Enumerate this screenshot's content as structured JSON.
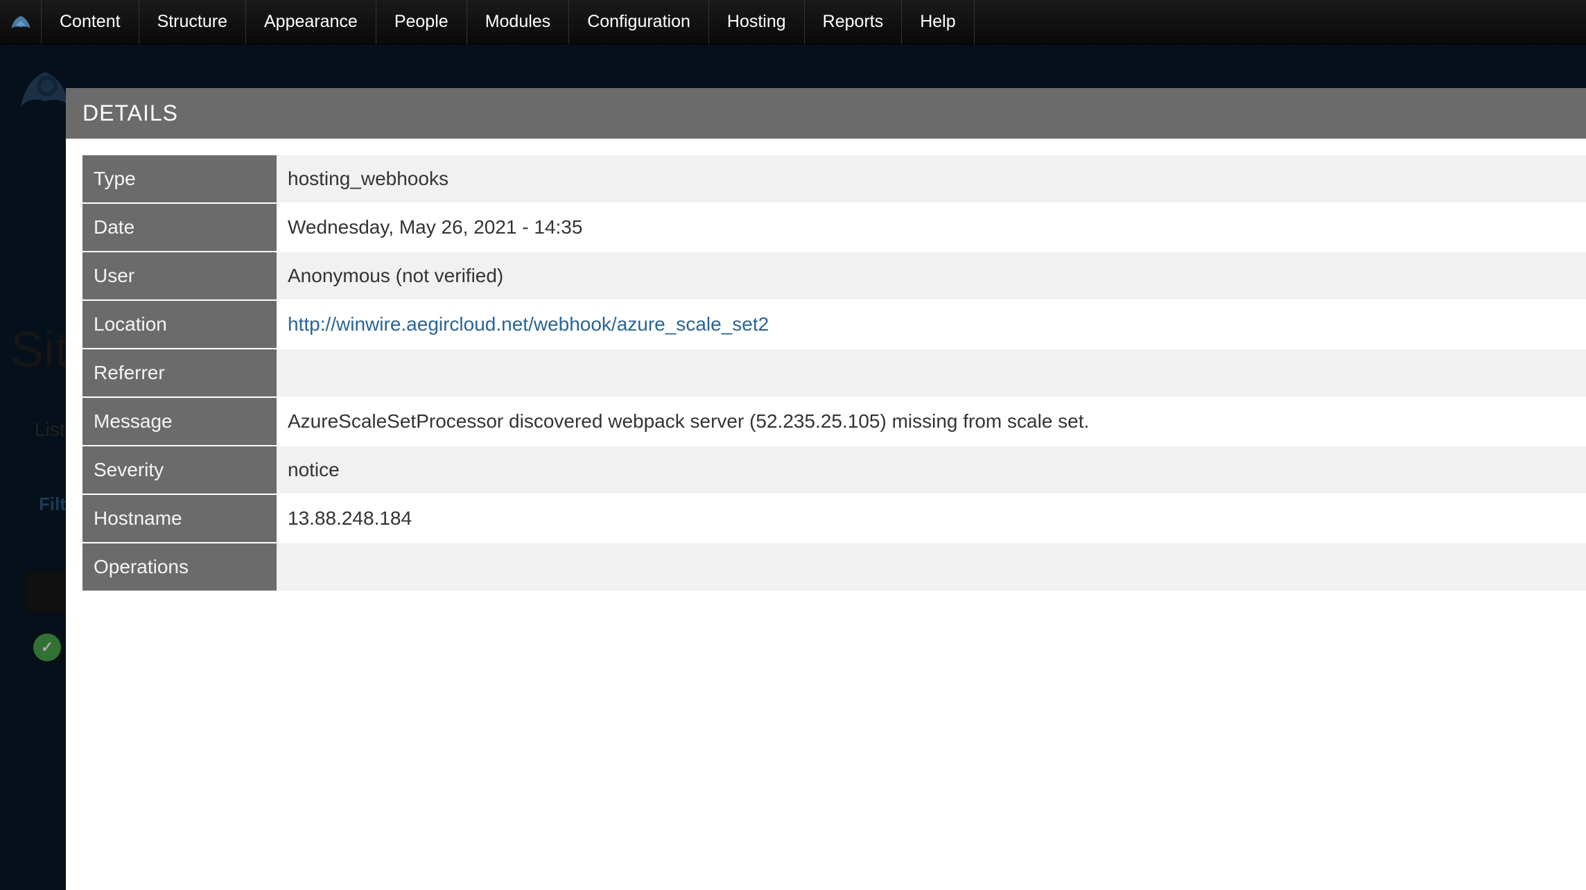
{
  "toolbar": {
    "items": [
      "Content",
      "Structure",
      "Appearance",
      "People",
      "Modules",
      "Configuration",
      "Hosting",
      "Reports",
      "Help"
    ]
  },
  "background": {
    "title_partial": "Sit",
    "list_label": "List",
    "filter_label": "Filt"
  },
  "details": {
    "header": "DETAILS",
    "rows": [
      {
        "label": "Type",
        "value": "hosting_webhooks",
        "is_link": false
      },
      {
        "label": "Date",
        "value": "Wednesday, May 26, 2021 - 14:35",
        "is_link": false
      },
      {
        "label": "User",
        "value": "Anonymous (not verified)",
        "is_link": false
      },
      {
        "label": "Location",
        "value": "http://winwire.aegircloud.net/webhook/azure_scale_set2",
        "is_link": true
      },
      {
        "label": "Referrer",
        "value": "",
        "is_link": false
      },
      {
        "label": "Message",
        "value": "AzureScaleSetProcessor discovered webpack server (52.235.25.105) missing from scale set.",
        "is_link": false
      },
      {
        "label": "Severity",
        "value": "notice",
        "is_link": false
      },
      {
        "label": "Hostname",
        "value": "13.88.248.184",
        "is_link": false
      },
      {
        "label": "Operations",
        "value": "",
        "is_link": false
      }
    ]
  }
}
